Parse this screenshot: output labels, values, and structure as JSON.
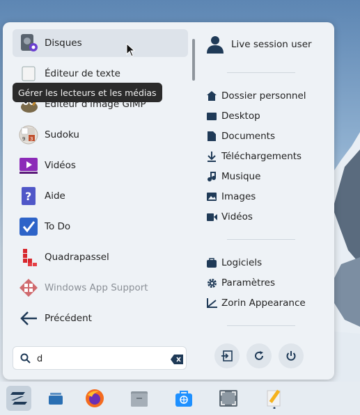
{
  "apps": [
    {
      "label": "Disques",
      "icon": "disks-icon"
    },
    {
      "label": "Éditeur de texte",
      "icon": "text-editor-icon"
    },
    {
      "label": "Éditeur d'image GIMP",
      "icon": "gimp-icon"
    },
    {
      "label": "Sudoku",
      "icon": "sudoku-icon"
    },
    {
      "label": "Vidéos",
      "icon": "videos-app-icon"
    },
    {
      "label": "Aide",
      "icon": "help-icon"
    },
    {
      "label": "To Do",
      "icon": "todo-icon"
    },
    {
      "label": "Quadrapassel",
      "icon": "quadrapassel-icon"
    },
    {
      "label": "Windows App Support",
      "icon": "windows-app-support-icon"
    },
    {
      "label": "Précédent",
      "icon": "back-arrow-icon"
    }
  ],
  "tooltip": "Gérer les lecteurs et les médias",
  "search": {
    "value": "d"
  },
  "user": {
    "label": "Live session user"
  },
  "places": [
    {
      "label": "Dossier personnel",
      "icon": "home-icon"
    },
    {
      "label": "Desktop",
      "icon": "desktop-icon"
    },
    {
      "label": "Documents",
      "icon": "document-icon"
    },
    {
      "label": "Téléchargements",
      "icon": "download-icon"
    },
    {
      "label": "Musique",
      "icon": "music-icon"
    },
    {
      "label": "Images",
      "icon": "image-icon"
    },
    {
      "label": "Vidéos",
      "icon": "video-icon"
    }
  ],
  "system": [
    {
      "label": "Logiciels",
      "icon": "software-bag-icon"
    },
    {
      "label": "Paramètres",
      "icon": "gear-icon"
    },
    {
      "label": "Zorin Appearance",
      "icon": "appearance-icon"
    }
  ],
  "power_buttons": [
    "logout-icon",
    "restart-icon",
    "power-icon"
  ],
  "taskbar": [
    "zorin-menu-icon",
    "workspaces-icon",
    "firefox-icon",
    "files-icon",
    "software-store-icon",
    "screenshot-icon",
    "text-editor-icon"
  ],
  "colors": {
    "accent": "#1f3a57",
    "menu_bg": "#eef2f6",
    "highlight": "#dde3ea"
  }
}
